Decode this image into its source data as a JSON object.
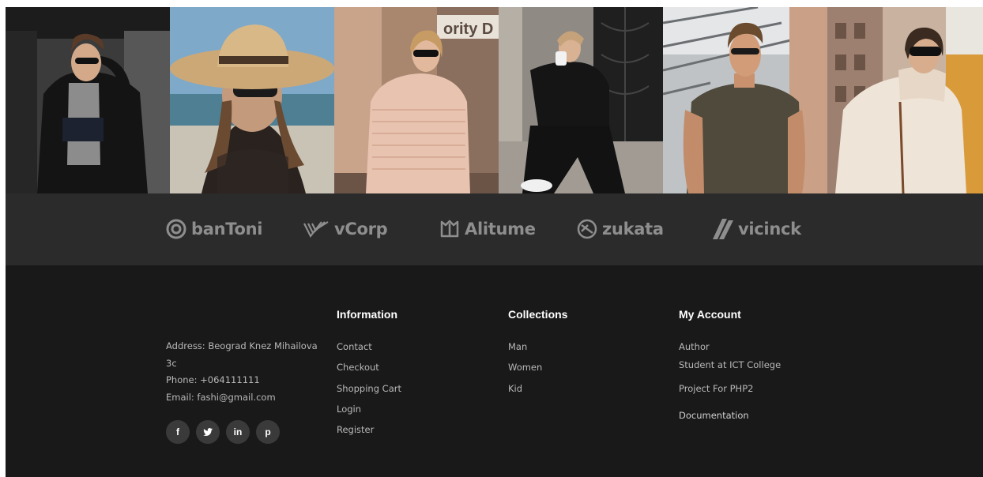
{
  "gallery": {
    "photos": [
      {
        "name": "photo-puffer-jacket-woman"
      },
      {
        "name": "photo-straw-hat-woman"
      },
      {
        "name": "photo-pink-sweater-woman"
      },
      {
        "name": "photo-black-outfit-woman"
      },
      {
        "name": "photo-olive-tshirt-man"
      },
      {
        "name": "photo-turtleneck-woman"
      }
    ],
    "sign_text": "ority D"
  },
  "partners": [
    {
      "label": "banToni",
      "icon": "ring-icon"
    },
    {
      "label": "vCorp",
      "icon": "stripes-icon"
    },
    {
      "label": "Alitume",
      "icon": "tulip-icon"
    },
    {
      "label": "zukata",
      "icon": "twist-icon"
    },
    {
      "label": "vicinck",
      "icon": "slash-icon"
    }
  ],
  "footer": {
    "address_line1": "Address: Beograd Knez Mihailova",
    "address_line2": "3c",
    "phone": "Phone: +064111111",
    "email": "Email: fashi@gmail.com",
    "social": [
      {
        "label": "f",
        "icon": "facebook-icon"
      },
      {
        "label": "twitter",
        "icon": "twitter-icon"
      },
      {
        "label": "in",
        "icon": "linkedin-icon"
      },
      {
        "label": "p",
        "icon": "pinterest-icon"
      }
    ],
    "information": {
      "title": "Information",
      "links": [
        "Contact",
        "Checkout",
        "Shopping Cart",
        "Login",
        "Register"
      ]
    },
    "collections": {
      "title": "Collections",
      "links": [
        "Man",
        "Women",
        "Kid"
      ]
    },
    "account": {
      "title": "My Account",
      "author": "Author",
      "student": "Student at ICT College",
      "project": "Project For PHP2",
      "documentation": "Documentation"
    }
  },
  "colors": {
    "partner_bg": "#2b2b2b",
    "footer_bg": "#191919",
    "text_primary": "#ffffff",
    "text_secondary": "#b8b8b8",
    "text_muted": "#4a4a4a",
    "logo_gray": "#8e8e8e"
  }
}
